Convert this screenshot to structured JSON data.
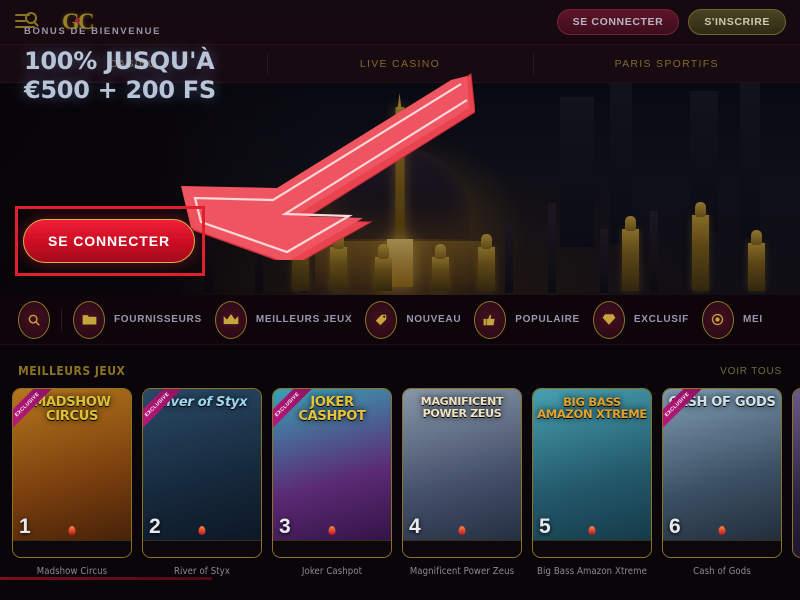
{
  "header": {
    "menu_icon": "menu-search-icon",
    "logo_text": "GC",
    "login_label": "SE CONNECTER",
    "signup_label": "S'INSCRIRE"
  },
  "nav": {
    "tabs": [
      {
        "label": "CASINO"
      },
      {
        "label": "LIVE CASINO"
      },
      {
        "label": "PARIS SPORTIFS"
      }
    ]
  },
  "hero": {
    "eyebrow": "BONUS DE BIENVENUE",
    "headline_line1": "100% JUSQU'À",
    "headline_line2": "€500 + 200 FS",
    "cta_label": "SE CONNECTER",
    "highlight_color": "#e02030",
    "arrow_color": "#e8434f"
  },
  "categories": {
    "search_icon": "search-icon",
    "items": [
      {
        "label": "FOURNISSEURS",
        "icon": "folder-icon"
      },
      {
        "label": "MEILLEURS JEUX",
        "icon": "crown-icon"
      },
      {
        "label": "NOUVEAU",
        "icon": "tag-icon"
      },
      {
        "label": "POPULAIRE",
        "icon": "thumbs-up-icon"
      },
      {
        "label": "EXCLUSIF",
        "icon": "diamond-icon"
      },
      {
        "label": "MEI",
        "icon": "medal-icon"
      }
    ]
  },
  "section": {
    "title": "MEILLEURS JEUX",
    "see_all": "VOIR TOUS"
  },
  "games": [
    {
      "num": "1",
      "name": "Madshow Circus",
      "art_title": "MADSHOW CIRCUS",
      "badge": "EXCLUSIVE",
      "title_color": "#d9c23a",
      "bg_from": "#b4761c",
      "bg_to": "#4a2208"
    },
    {
      "num": "2",
      "name": "River of Styx",
      "art_title": "River of Styx",
      "badge": "EXCLUSIVE",
      "title_color": "#9fd8ee",
      "bg_from": "#2a4a66",
      "bg_to": "#0d1824"
    },
    {
      "num": "3",
      "name": "Joker Cashpot",
      "art_title": "JOKER CASHPOT",
      "badge": "EXCLUSIVE",
      "title_color": "#e8c33a",
      "bg_from": "#3aa0b4",
      "bg_to": "#3a1550"
    },
    {
      "num": "4",
      "name": "Magnificent Power Zeus",
      "art_title": "MAGNIFICENT POWER ZEUS",
      "badge": "",
      "title_color": "#f0e4c0",
      "bg_from": "#7e8ea0",
      "bg_to": "#2a3344"
    },
    {
      "num": "5",
      "name": "Big Bass Amazon Xtreme",
      "art_title": "BIG BASS AMAZON XTREME",
      "badge": "",
      "title_color": "#e8a22a",
      "bg_from": "#3e8fa0",
      "bg_to": "#1d4452"
    },
    {
      "num": "6",
      "name": "Cash of Gods",
      "art_title": "CASH OF GODS",
      "badge": "EXCLUSIVE",
      "title_color": "#cfe2e8",
      "bg_from": "#6f8fa8",
      "bg_to": "#24323f"
    }
  ]
}
